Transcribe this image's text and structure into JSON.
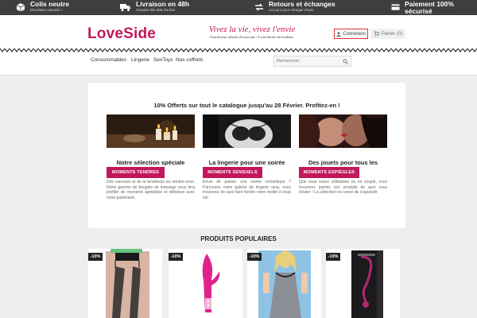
{
  "topbar": {
    "items": [
      {
        "title": "Colis neutre",
        "subtitle": "Discrétion assurée !",
        "icon": "package-icon"
      },
      {
        "title": "Livraison en 48h",
        "subtitle": "Gratuite dès 69€ d'achat",
        "icon": "truck-icon"
      },
      {
        "title": "Retours et échanges",
        "subtitle": "14 jours pour changer d'avis",
        "icon": "exchange-arrows-icon"
      },
      {
        "title": "Paiement 100% sécurisé",
        "subtitle": "Verified by Visa, SSL, SiteLock",
        "icon": "credit-card-icon"
      }
    ],
    "background": "#3e3e3e"
  },
  "header": {
    "logo": "LoveSide",
    "tagline": "Vivez la vie, vivez l'envie",
    "tagline_sub": "Fournisseur officiel d'ocytocine ! La molécule du bonheur.",
    "login_label": "Connexion",
    "cart_label": "Panier (0)",
    "brand_color": "#c2185b"
  },
  "nav": {
    "items": [
      "Consommables",
      "Lingerie",
      "SexToys",
      "Nos coffrets"
    ],
    "search_placeholder": "Rechercher"
  },
  "promo": {
    "headline": "10% Offerts sur tout le catalogue jusqu'au 28 Février. Profitez-en !",
    "columns": [
      {
        "title": "Notre sélection spéciale massages",
        "text": "Des caresses et de la tendresse au rendez-vous. Notre gamme de bougies de massage vous fera profiter de moments agréables et délicieux avec votre partenaire.",
        "button": "MOMENTS TENDRES",
        "image": "massage-candles"
      },
      {
        "title": "La lingerie pour une soirée séduction",
        "text": "Envie de passer une soirée romantique ? Parcourez notre galerie de lingerie sexy, vous trouverez de quoi faire fondre votre moitié à coup sûr.",
        "button": "MOMENTS SENSUELS",
        "image": "lingerie-black-white"
      },
      {
        "title": "Des jouets pour tous les adultes",
        "text": "Que vous soyez célibataire ou en couple, vous trouverez parmis nos produits de quoi vous éclater ! La collection ne cesse de s'agrandir.",
        "button": "MOMENTS ESPIÈGLES",
        "image": "couple-kiss"
      }
    ]
  },
  "popular": {
    "title": "PRODUITS POPULAIRES",
    "products": [
      {
        "badge": "-10%",
        "image": "stockings-garter"
      },
      {
        "badge": "-10%",
        "image": "pink-rabbit-vibrator"
      },
      {
        "badge": "-10%",
        "image": "silver-nightdress"
      },
      {
        "badge": "-10%",
        "image": "black-box-product"
      }
    ]
  }
}
